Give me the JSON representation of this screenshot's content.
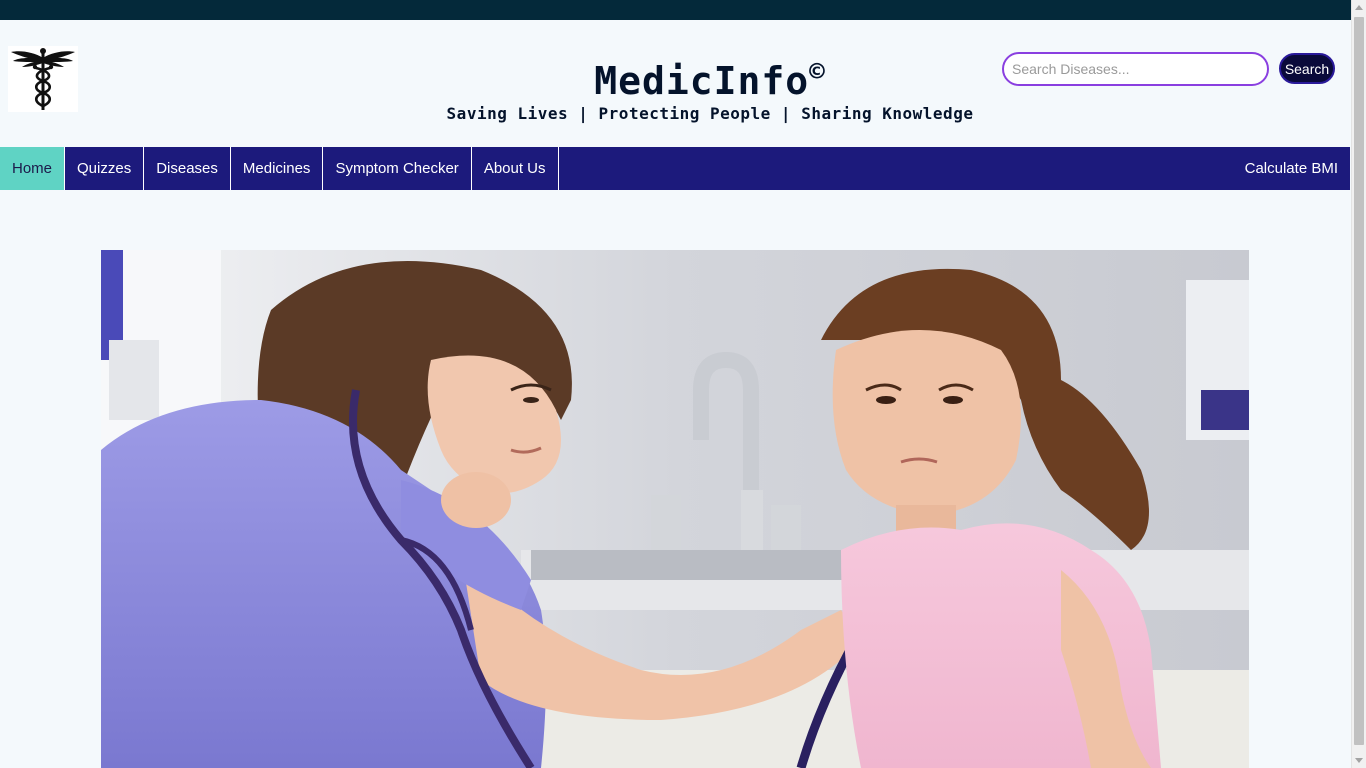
{
  "header": {
    "site_title": "MedicInfo",
    "copyright_mark": "©",
    "tagline": "Saving Lives | Protecting People | Sharing Knowledge",
    "logo_icon": "caduceus-icon"
  },
  "search": {
    "placeholder": "Search Diseases...",
    "value": "",
    "button_label": "Search"
  },
  "nav": {
    "items": [
      {
        "label": "Home",
        "active": true
      },
      {
        "label": "Quizzes"
      },
      {
        "label": "Diseases"
      },
      {
        "label": "Medicines"
      },
      {
        "label": "Symptom Checker"
      },
      {
        "label": "About Us"
      }
    ],
    "right_item": "Calculate BMI"
  },
  "colors": {
    "top_strip": "#04293a",
    "nav_bg": "#1c1a7c",
    "nav_active": "#5fd3c4",
    "page_bg": "#f4f9fc",
    "search_border": "#8a3fe0"
  },
  "hero": {
    "image": "nurse-examining-child-photo"
  }
}
